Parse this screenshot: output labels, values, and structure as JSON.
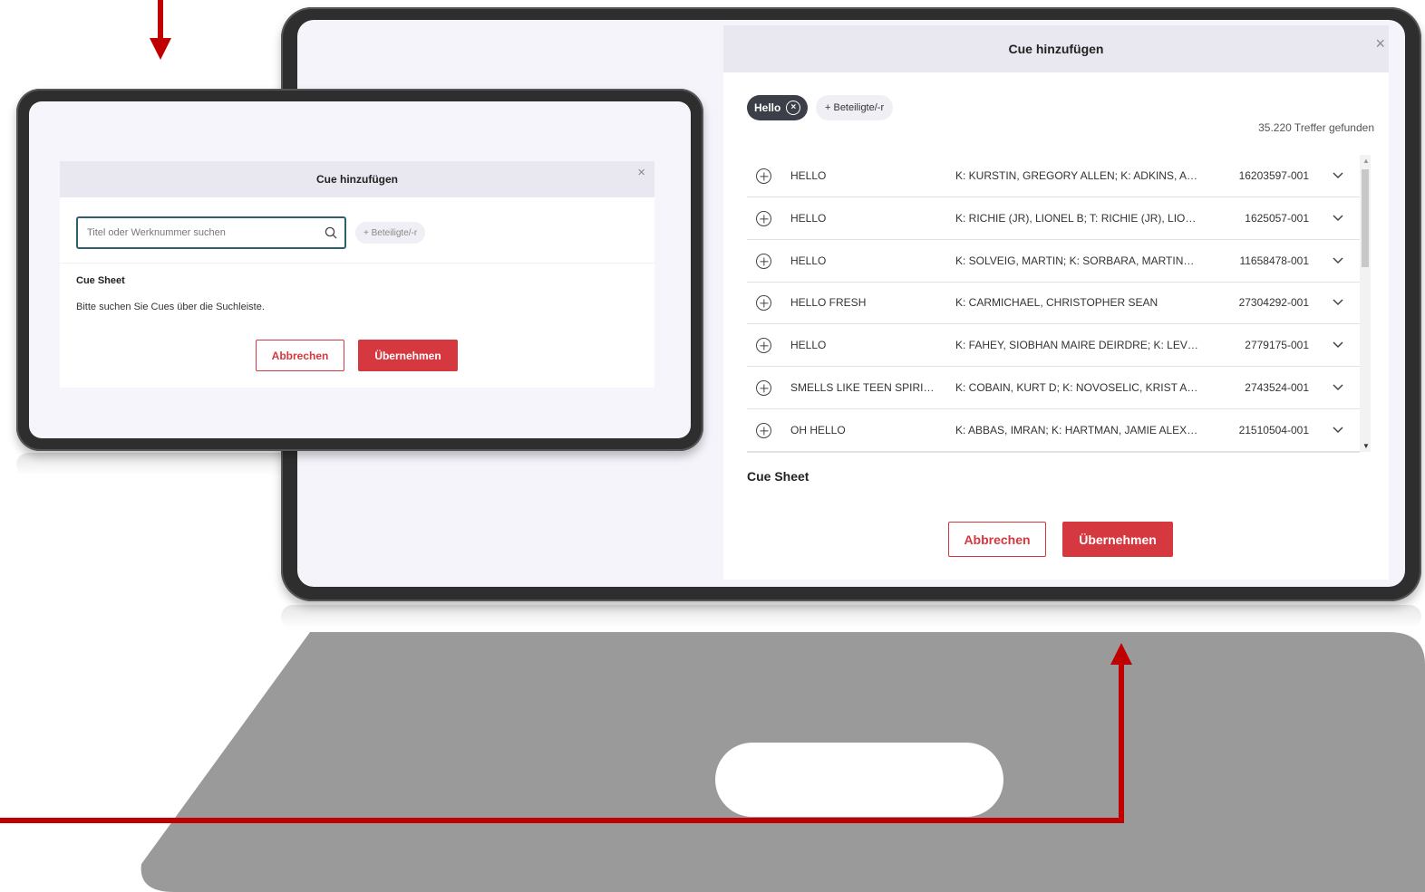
{
  "colors": {
    "accent_red": "#d6383f",
    "arrow_red": "#c00000",
    "dialog_header": "#e9e8f1",
    "device_frame": "#2e2e2e",
    "base_gray": "#9a9a9a",
    "chip_dark": "#3c3f48"
  },
  "small_dialog": {
    "title": "Cue hinzufügen",
    "close_icon": "×",
    "search_placeholder": "Titel oder Werknummer suchen",
    "search_icon": "search-icon",
    "participants_chip": "+ Beteiligte/-r",
    "section_title": "Cue Sheet",
    "empty_hint": "Bitte suchen Sie Cues über die Suchleiste.",
    "cancel_label": "Abbrechen",
    "apply_label": "Übernehmen"
  },
  "large_dialog": {
    "title": "Cue hinzufügen",
    "close_icon": "×",
    "filter_chip_label": "Hello",
    "filter_chip_icon": "close-circle-icon",
    "participants_chip": "+ Beteiligte/-r",
    "result_count": "35.220 Treffer gefunden",
    "results": [
      {
        "title": "HELLO",
        "participants": "K: KURSTIN, GREGORY ALLEN; K: ADKINS, ADEL...",
        "number": "16203597-001"
      },
      {
        "title": "HELLO",
        "participants": "K: RICHIE (JR), LIONEL B; T: RICHIE (JR), LIONEL B...",
        "number": "1625057-001"
      },
      {
        "title": "HELLO",
        "participants": "K: SOLVEIG, MARTIN; K: SORBARA, MARTINA; T: ...",
        "number": "11658478-001"
      },
      {
        "title": "HELLO FRESH",
        "participants": "K: CARMICHAEL, CHRISTOPHER SEAN",
        "number": "27304292-001"
      },
      {
        "title": "HELLO",
        "participants": "K: FAHEY, SIOBHAN MAIRE DEIRDRE; K: LEVY, M...",
        "number": "2779175-001"
      },
      {
        "title": "SMELLS LIKE TEEN SPIRIT (U...",
        "participants": "K: COBAIN, KURT D; K: NOVOSELIC, KRIST ANTH...",
        "number": "2743524-001"
      },
      {
        "title": "OH HELLO",
        "participants": "K: ABBAS, IMRAN; K: HARTMAN, JAMIE ALEXAN...",
        "number": "21510504-001"
      }
    ],
    "row_add_icon": "plus-circle-icon",
    "row_expand_icon": "chevron-down-icon",
    "section_title": "Cue Sheet",
    "cancel_label": "Abbrechen",
    "apply_label": "Übernehmen"
  }
}
